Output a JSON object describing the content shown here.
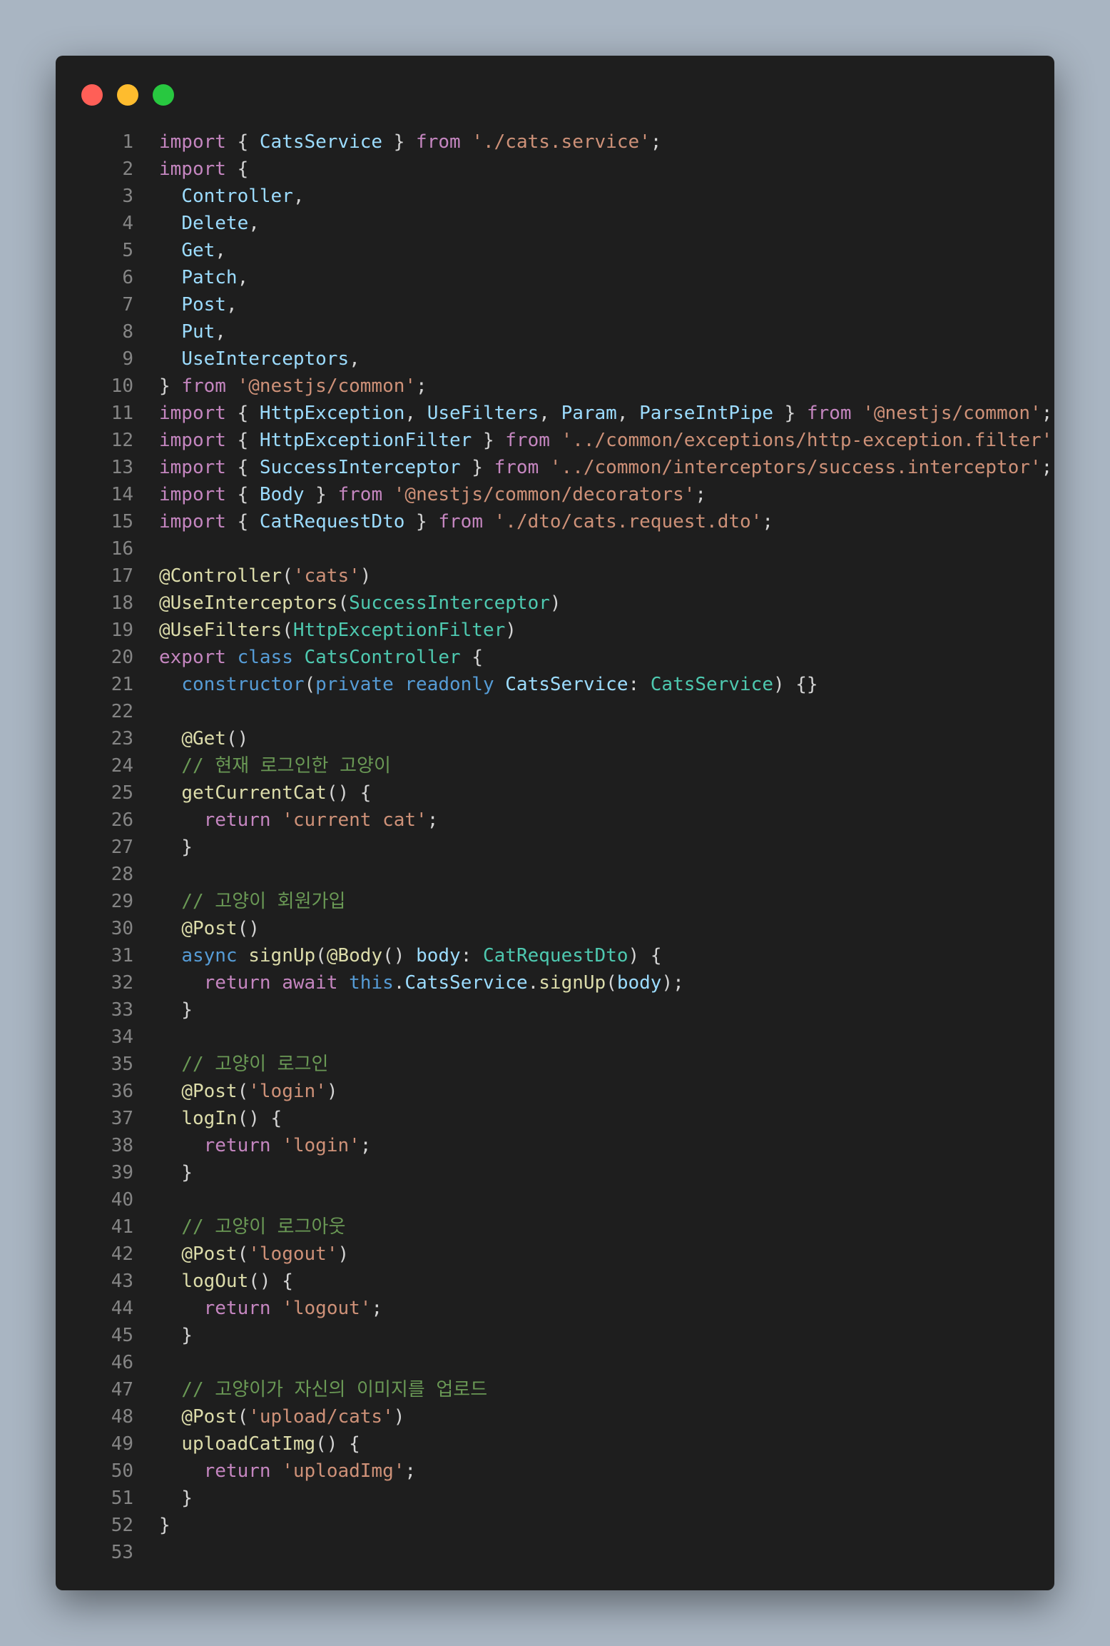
{
  "window": {
    "controls": [
      "close",
      "minimize",
      "maximize"
    ]
  },
  "colors": {
    "page_background": "#a9b5c2",
    "editor_background": "#1e1e1e",
    "line_number": "#858585",
    "keyword_control": "#c586c0",
    "keyword_storage": "#569cd6",
    "identifier": "#9cdcfe",
    "string": "#ce9178",
    "class_name": "#4ec9b0",
    "function": "#dcdcaa",
    "comment": "#6a9955",
    "punctuation": "#d4d4d4"
  },
  "code_lines": [
    [
      [
        "kw",
        "import"
      ],
      [
        "p",
        " { "
      ],
      [
        "id",
        "CatsService"
      ],
      [
        "p",
        " } "
      ],
      [
        "kw",
        "from"
      ],
      [
        "p",
        " "
      ],
      [
        "str",
        "'./cats.service'"
      ],
      [
        "p",
        ";"
      ]
    ],
    [
      [
        "kw",
        "import"
      ],
      [
        "p",
        " {"
      ]
    ],
    [
      [
        "p",
        "  "
      ],
      [
        "id",
        "Controller"
      ],
      [
        "p",
        ","
      ]
    ],
    [
      [
        "p",
        "  "
      ],
      [
        "id",
        "Delete"
      ],
      [
        "p",
        ","
      ]
    ],
    [
      [
        "p",
        "  "
      ],
      [
        "id",
        "Get"
      ],
      [
        "p",
        ","
      ]
    ],
    [
      [
        "p",
        "  "
      ],
      [
        "id",
        "Patch"
      ],
      [
        "p",
        ","
      ]
    ],
    [
      [
        "p",
        "  "
      ],
      [
        "id",
        "Post"
      ],
      [
        "p",
        ","
      ]
    ],
    [
      [
        "p",
        "  "
      ],
      [
        "id",
        "Put"
      ],
      [
        "p",
        ","
      ]
    ],
    [
      [
        "p",
        "  "
      ],
      [
        "id",
        "UseInterceptors"
      ],
      [
        "p",
        ","
      ]
    ],
    [
      [
        "p",
        "} "
      ],
      [
        "kw",
        "from"
      ],
      [
        "p",
        " "
      ],
      [
        "str",
        "'@nestjs/common'"
      ],
      [
        "p",
        ";"
      ]
    ],
    [
      [
        "kw",
        "import"
      ],
      [
        "p",
        " { "
      ],
      [
        "id",
        "HttpException"
      ],
      [
        "p",
        ", "
      ],
      [
        "id",
        "UseFilters"
      ],
      [
        "p",
        ", "
      ],
      [
        "id",
        "Param"
      ],
      [
        "p",
        ", "
      ],
      [
        "id",
        "ParseIntPipe"
      ],
      [
        "p",
        " } "
      ],
      [
        "kw",
        "from"
      ],
      [
        "p",
        " "
      ],
      [
        "str",
        "'@nestjs/common'"
      ],
      [
        "p",
        ";"
      ]
    ],
    [
      [
        "kw",
        "import"
      ],
      [
        "p",
        " { "
      ],
      [
        "id",
        "HttpExceptionFilter"
      ],
      [
        "p",
        " } "
      ],
      [
        "kw",
        "from"
      ],
      [
        "p",
        " "
      ],
      [
        "str",
        "'../common/exceptions/http-exception.filter'"
      ],
      [
        "p",
        ";"
      ]
    ],
    [
      [
        "kw",
        "import"
      ],
      [
        "p",
        " { "
      ],
      [
        "id",
        "SuccessInterceptor"
      ],
      [
        "p",
        " } "
      ],
      [
        "kw",
        "from"
      ],
      [
        "p",
        " "
      ],
      [
        "str",
        "'../common/interceptors/success.interceptor'"
      ],
      [
        "p",
        ";"
      ]
    ],
    [
      [
        "kw",
        "import"
      ],
      [
        "p",
        " { "
      ],
      [
        "id",
        "Body"
      ],
      [
        "p",
        " } "
      ],
      [
        "kw",
        "from"
      ],
      [
        "p",
        " "
      ],
      [
        "str",
        "'@nestjs/common/decorators'"
      ],
      [
        "p",
        ";"
      ]
    ],
    [
      [
        "kw",
        "import"
      ],
      [
        "p",
        " { "
      ],
      [
        "id",
        "CatRequestDto"
      ],
      [
        "p",
        " } "
      ],
      [
        "kw",
        "from"
      ],
      [
        "p",
        " "
      ],
      [
        "str",
        "'./dto/cats.request.dto'"
      ],
      [
        "p",
        ";"
      ]
    ],
    [],
    [
      [
        "fn",
        "@Controller"
      ],
      [
        "p",
        "("
      ],
      [
        "str",
        "'cats'"
      ],
      [
        "p",
        ")"
      ]
    ],
    [
      [
        "fn",
        "@UseInterceptors"
      ],
      [
        "p",
        "("
      ],
      [
        "cls",
        "SuccessInterceptor"
      ],
      [
        "p",
        ")"
      ]
    ],
    [
      [
        "fn",
        "@UseFilters"
      ],
      [
        "p",
        "("
      ],
      [
        "cls",
        "HttpExceptionFilter"
      ],
      [
        "p",
        ")"
      ]
    ],
    [
      [
        "kw",
        "export"
      ],
      [
        "p",
        " "
      ],
      [
        "sk",
        "class"
      ],
      [
        "p",
        " "
      ],
      [
        "cls",
        "CatsController"
      ],
      [
        "p",
        " {"
      ]
    ],
    [
      [
        "p",
        "  "
      ],
      [
        "sk",
        "constructor"
      ],
      [
        "p",
        "("
      ],
      [
        "sk",
        "private"
      ],
      [
        "p",
        " "
      ],
      [
        "sk",
        "readonly"
      ],
      [
        "p",
        " "
      ],
      [
        "id",
        "CatsService"
      ],
      [
        "p",
        ": "
      ],
      [
        "cls",
        "CatsService"
      ],
      [
        "p",
        ") {}"
      ]
    ],
    [],
    [
      [
        "p",
        "  "
      ],
      [
        "fn",
        "@Get"
      ],
      [
        "p",
        "()"
      ]
    ],
    [
      [
        "p",
        "  "
      ],
      [
        "com",
        "// 현재 로그인한 고양이"
      ]
    ],
    [
      [
        "p",
        "  "
      ],
      [
        "fn",
        "getCurrentCat"
      ],
      [
        "p",
        "() {"
      ]
    ],
    [
      [
        "p",
        "    "
      ],
      [
        "kw",
        "return"
      ],
      [
        "p",
        " "
      ],
      [
        "str",
        "'current cat'"
      ],
      [
        "p",
        ";"
      ]
    ],
    [
      [
        "p",
        "  }"
      ]
    ],
    [],
    [
      [
        "p",
        "  "
      ],
      [
        "com",
        "// 고양이 회원가입"
      ]
    ],
    [
      [
        "p",
        "  "
      ],
      [
        "fn",
        "@Post"
      ],
      [
        "p",
        "()"
      ]
    ],
    [
      [
        "p",
        "  "
      ],
      [
        "sk",
        "async"
      ],
      [
        "p",
        " "
      ],
      [
        "fn",
        "signUp"
      ],
      [
        "p",
        "("
      ],
      [
        "fn",
        "@Body"
      ],
      [
        "p",
        "() "
      ],
      [
        "id",
        "body"
      ],
      [
        "p",
        ": "
      ],
      [
        "cls",
        "CatRequestDto"
      ],
      [
        "p",
        ") {"
      ]
    ],
    [
      [
        "p",
        "    "
      ],
      [
        "kw",
        "return"
      ],
      [
        "p",
        " "
      ],
      [
        "kw",
        "await"
      ],
      [
        "p",
        " "
      ],
      [
        "sk",
        "this"
      ],
      [
        "p",
        "."
      ],
      [
        "id",
        "CatsService"
      ],
      [
        "p",
        "."
      ],
      [
        "fn",
        "signUp"
      ],
      [
        "p",
        "("
      ],
      [
        "id",
        "body"
      ],
      [
        "p",
        ");"
      ]
    ],
    [
      [
        "p",
        "  }"
      ]
    ],
    [],
    [
      [
        "p",
        "  "
      ],
      [
        "com",
        "// 고양이 로그인"
      ]
    ],
    [
      [
        "p",
        "  "
      ],
      [
        "fn",
        "@Post"
      ],
      [
        "p",
        "("
      ],
      [
        "str",
        "'login'"
      ],
      [
        "p",
        ")"
      ]
    ],
    [
      [
        "p",
        "  "
      ],
      [
        "fn",
        "logIn"
      ],
      [
        "p",
        "() {"
      ]
    ],
    [
      [
        "p",
        "    "
      ],
      [
        "kw",
        "return"
      ],
      [
        "p",
        " "
      ],
      [
        "str",
        "'login'"
      ],
      [
        "p",
        ";"
      ]
    ],
    [
      [
        "p",
        "  }"
      ]
    ],
    [],
    [
      [
        "p",
        "  "
      ],
      [
        "com",
        "// 고양이 로그아웃"
      ]
    ],
    [
      [
        "p",
        "  "
      ],
      [
        "fn",
        "@Post"
      ],
      [
        "p",
        "("
      ],
      [
        "str",
        "'logout'"
      ],
      [
        "p",
        ")"
      ]
    ],
    [
      [
        "p",
        "  "
      ],
      [
        "fn",
        "logOut"
      ],
      [
        "p",
        "() {"
      ]
    ],
    [
      [
        "p",
        "    "
      ],
      [
        "kw",
        "return"
      ],
      [
        "p",
        " "
      ],
      [
        "str",
        "'logout'"
      ],
      [
        "p",
        ";"
      ]
    ],
    [
      [
        "p",
        "  }"
      ]
    ],
    [],
    [
      [
        "p",
        "  "
      ],
      [
        "com",
        "// 고양이가 자신의 이미지를 업로드"
      ]
    ],
    [
      [
        "p",
        "  "
      ],
      [
        "fn",
        "@Post"
      ],
      [
        "p",
        "("
      ],
      [
        "str",
        "'upload/cats'"
      ],
      [
        "p",
        ")"
      ]
    ],
    [
      [
        "p",
        "  "
      ],
      [
        "fn",
        "uploadCatImg"
      ],
      [
        "p",
        "() {"
      ]
    ],
    [
      [
        "p",
        "    "
      ],
      [
        "kw",
        "return"
      ],
      [
        "p",
        " "
      ],
      [
        "str",
        "'uploadImg'"
      ],
      [
        "p",
        ";"
      ]
    ],
    [
      [
        "p",
        "  }"
      ]
    ],
    [
      [
        "p",
        "}"
      ]
    ],
    []
  ]
}
